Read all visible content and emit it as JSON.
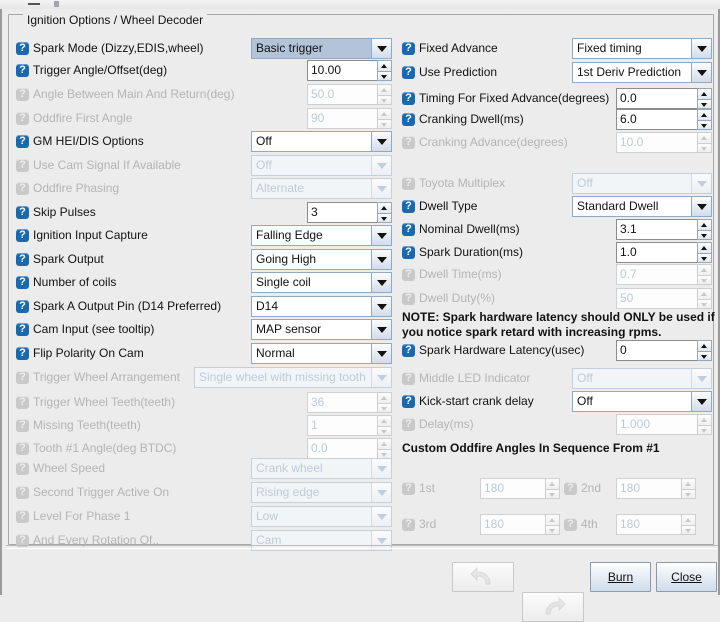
{
  "window": {
    "minimize_glyph": "—"
  },
  "group": {
    "title": "Ignition Options / Wheel Decoder"
  },
  "left_rows": [
    {
      "label": "Spark Mode (Dizzy,EDIS,wheel)",
      "ctrl": "combo",
      "value": "Basic trigger",
      "enabled": true,
      "selected": true
    },
    {
      "label": "Trigger Angle/Offset(deg)",
      "ctrl": "spin",
      "value": "10.00",
      "enabled": true
    },
    {
      "label": "Angle Between Main And Return(deg)",
      "ctrl": "spin",
      "value": "50.0",
      "enabled": false
    },
    {
      "label": "Oddfire First Angle",
      "ctrl": "spin",
      "value": "90",
      "enabled": false
    },
    {
      "label": "GM HEI/DIS Options",
      "ctrl": "combo",
      "value": "Off",
      "enabled": true
    },
    {
      "label": "Use Cam Signal If Available",
      "ctrl": "combo",
      "value": "Off",
      "enabled": false
    },
    {
      "label": "Oddfire Phasing",
      "ctrl": "combo",
      "value": "Alternate",
      "enabled": false
    },
    {
      "label": "Skip Pulses",
      "ctrl": "spin",
      "value": "3",
      "enabled": true
    },
    {
      "label": "Ignition Input Capture",
      "ctrl": "combo",
      "value": "Falling Edge",
      "enabled": true
    },
    {
      "label": "Spark Output",
      "ctrl": "combo",
      "value": "Going High",
      "enabled": true
    },
    {
      "label": "Number of coils",
      "ctrl": "combo",
      "value": "Single coil",
      "enabled": true
    },
    {
      "label": "Spark A Output Pin (D14 Preferred)",
      "ctrl": "combo",
      "value": "D14",
      "enabled": true
    },
    {
      "label": "Cam Input (see tooltip)",
      "ctrl": "combo",
      "value": "MAP sensor",
      "enabled": true
    },
    {
      "label": "Flip Polarity On Cam",
      "ctrl": "combo",
      "value": "Normal",
      "enabled": true
    },
    {
      "label": "Trigger Wheel Arrangement",
      "ctrl": "combo-wide",
      "value": "Single wheel with missing tooth",
      "enabled": false
    },
    {
      "label": "Trigger Wheel Teeth(teeth)",
      "ctrl": "spin",
      "value": "36",
      "enabled": false
    },
    {
      "label": "Missing Teeth(teeth)",
      "ctrl": "spin",
      "value": "1",
      "enabled": false
    },
    {
      "label": "Tooth #1 Angle(deg BTDC)",
      "ctrl": "spin",
      "value": "0.0",
      "enabled": false
    },
    {
      "label": "Wheel Speed",
      "ctrl": "combo",
      "value": "Crank wheel",
      "enabled": false
    },
    {
      "label": "Second Trigger Active On",
      "ctrl": "combo",
      "value": "Rising edge",
      "enabled": false
    },
    {
      "label": "Level For Phase 1",
      "ctrl": "combo",
      "value": "Low",
      "enabled": false
    },
    {
      "label": "And Every Rotation Of..",
      "ctrl": "combo",
      "value": "Cam",
      "enabled": false
    }
  ],
  "right_rows": [
    {
      "label": "Fixed Advance",
      "ctrl": "combo",
      "value": "Fixed timing",
      "enabled": true
    },
    {
      "label": "Use Prediction",
      "ctrl": "combo",
      "value": "1st Deriv Prediction",
      "enabled": true
    },
    {
      "label": "Timing For Fixed Advance(degrees)",
      "ctrl": "spin",
      "value": "0.0",
      "enabled": true
    },
    {
      "label": "Cranking Dwell(ms)",
      "ctrl": "spin",
      "value": "6.0",
      "enabled": true
    },
    {
      "label": "Cranking Advance(degrees)",
      "ctrl": "spin",
      "value": "10.0",
      "enabled": false
    },
    {
      "label": "Toyota Multiplex",
      "ctrl": "combo",
      "value": "Off",
      "enabled": false
    },
    {
      "label": "Dwell Type",
      "ctrl": "combo",
      "value": "Standard Dwell",
      "enabled": true
    },
    {
      "label": "Nominal Dwell(ms)",
      "ctrl": "spin",
      "value": "3.1",
      "enabled": true
    },
    {
      "label": "Spark Duration(ms)",
      "ctrl": "spin",
      "value": "1.0",
      "enabled": true
    },
    {
      "label": "Dwell Time(ms)",
      "ctrl": "spin",
      "value": "0.7",
      "enabled": false
    },
    {
      "label": "Dwell Duty(%)",
      "ctrl": "spin",
      "value": "50",
      "enabled": false
    },
    {
      "label": "Spark Hardware Latency(usec)",
      "ctrl": "spin",
      "value": "0",
      "enabled": true
    },
    {
      "label": "Middle LED Indicator",
      "ctrl": "combo",
      "value": "Off",
      "enabled": false
    },
    {
      "label": "Kick-start crank delay",
      "ctrl": "combo",
      "value": "Off",
      "enabled": true
    },
    {
      "label": "Delay(ms)",
      "ctrl": "spin",
      "value": "1.000",
      "enabled": false
    }
  ],
  "note": {
    "line1": "NOTE: Spark hardware latency should ONLY be used if",
    "line2": "you notice spark retard with increasing rpms."
  },
  "oddfire": {
    "heading": "Custom Oddfire Angles In Sequence From #1",
    "fields": [
      {
        "label": "1st",
        "value": "180",
        "enabled": false
      },
      {
        "label": "2nd",
        "value": "180",
        "enabled": false
      },
      {
        "label": "3rd",
        "value": "180",
        "enabled": false
      },
      {
        "label": "4th",
        "value": "180",
        "enabled": false
      }
    ]
  },
  "buttons": {
    "undo_icon": "undo-arrow-icon",
    "redo_icon": "redo-arrow-icon",
    "burn": {
      "pre": "B",
      "mnemonic": "",
      "text": "Burn"
    },
    "close": {
      "text": "Close"
    }
  },
  "colors": {
    "accent": "#1869b0",
    "panel_bg": "#ececec",
    "combo_border": "#8faac4",
    "selected_combo": "#b3c4d8"
  }
}
